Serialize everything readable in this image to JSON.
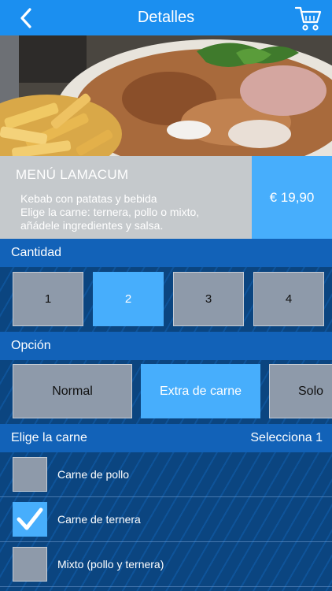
{
  "header": {
    "title": "Detalles",
    "back_icon": "chevron-left-icon",
    "cart_icon": "shopping-cart-icon"
  },
  "product": {
    "name": "MENÚ LAMACUM",
    "description_line1": "Kebab con patatas y bebida",
    "description_line2": "Elige la carne: ternera, pollo o mixto,",
    "description_line3": "añádele ingredientes y salsa.",
    "price": "€ 19,90"
  },
  "quantity": {
    "label": "Cantidad",
    "options": [
      "1",
      "2",
      "3",
      "4"
    ],
    "selected": "2"
  },
  "option": {
    "label": "Opción",
    "options": [
      "Normal",
      "Extra de carne",
      "Solo"
    ],
    "selected": "Extra de carne"
  },
  "meat": {
    "label": "Elige la carne",
    "hint": "Selecciona 1",
    "items": [
      {
        "label": "Carne de pollo",
        "checked": false
      },
      {
        "label": "Carne de ternera",
        "checked": true
      },
      {
        "label": "Mixto (pollo y ternera)",
        "checked": false
      }
    ]
  },
  "colors": {
    "accent": "#47aefc",
    "header": "#1b8ff0",
    "section": "#1262b8",
    "unselected": "#8e9aaa"
  }
}
